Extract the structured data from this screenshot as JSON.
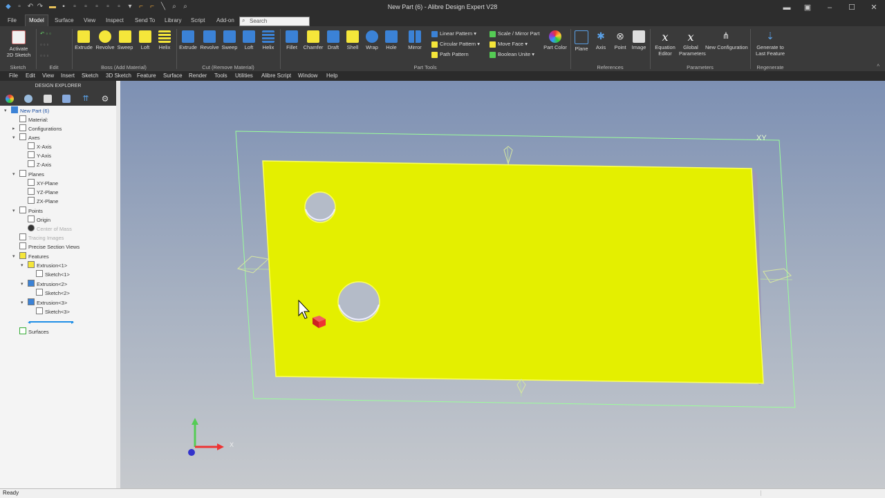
{
  "app": {
    "title": "New Part (6) - Alibre Design Expert V28"
  },
  "ribbon_tabs": [
    "File",
    "Model",
    "Surface",
    "View",
    "Inspect",
    "Send To",
    "Library",
    "Script",
    "Add-on"
  ],
  "active_tab": "Model",
  "search": {
    "placeholder": "Search"
  },
  "ribbon": {
    "sketch": {
      "activate": "Activate",
      "activate2": "2D Sketch",
      "group": "Sketch"
    },
    "edit": {
      "group": "Edit"
    },
    "boss": {
      "extrude": "Extrude",
      "revolve": "Revolve",
      "sweep": "Sweep",
      "loft": "Loft",
      "helix": "Helix",
      "group": "Boss (Add Material)"
    },
    "cut": {
      "extrude": "Extrude",
      "revolve": "Revolve",
      "sweep": "Sweep",
      "loft": "Loft",
      "helix": "Helix",
      "group": "Cut (Remove Material)"
    },
    "tools": {
      "fillet": "Fillet",
      "chamfer": "Chamfer",
      "draft": "Draft",
      "shell": "Shell",
      "wrap": "Wrap",
      "hole": "Hole",
      "mirror": "Mirror",
      "linear": "Linear Pattern",
      "circular": "Circular Pattern",
      "path": "Path Pattern",
      "scale": "Scale / Mirror Part",
      "move": "Move Face",
      "boolean": "Boolean Unite",
      "color": "Part Color",
      "group": "Part Tools"
    },
    "refs": {
      "plane": "Plane",
      "axis": "Axis",
      "point": "Point",
      "image": "Image",
      "group": "References"
    },
    "params": {
      "equation": "Equation",
      "equation2": "Editor",
      "global": "Global",
      "global2": "Parameters",
      "config": "New Configuration",
      "group": "Parameters"
    },
    "regen": {
      "gen": "Generate to",
      "gen2": "Last Feature",
      "group": "Regenerate"
    }
  },
  "menubar": [
    "File",
    "Edit",
    "View",
    "Insert",
    "Sketch",
    "3D Sketch",
    "Feature",
    "Surface",
    "Render",
    "Tools",
    "Utilities",
    "Alibre Script",
    "Window",
    "Help"
  ],
  "explorer": {
    "header": "DESIGN EXPLORER",
    "root": "New Part (6)",
    "items": [
      "Material:",
      "Configurations",
      "Axes",
      "X-Axis",
      "Y-Axis",
      "Z-Axis",
      "Planes",
      "XY-Plane",
      "YZ-Plane",
      "ZX-Plane",
      "Points",
      "Origin",
      "Center of Mass",
      "Tracing Images",
      "Precise Section Views",
      "Features",
      "Extrusion<1>",
      "Sketch<1>",
      "Extrusion<2>",
      "Sketch<2>",
      "Extrusion<3>",
      "Sketch<3>",
      "Surfaces"
    ]
  },
  "viewport": {
    "corner_label": "XY",
    "axis_x_label": "X"
  },
  "status": {
    "text": "Ready"
  },
  "colors": {
    "part_face": "#e4ef00",
    "part_edge": "#fbff60",
    "bbox": "#9bff9b",
    "viewport_top": "#7d90b3",
    "viewport_bottom": "#c6c9cd"
  }
}
